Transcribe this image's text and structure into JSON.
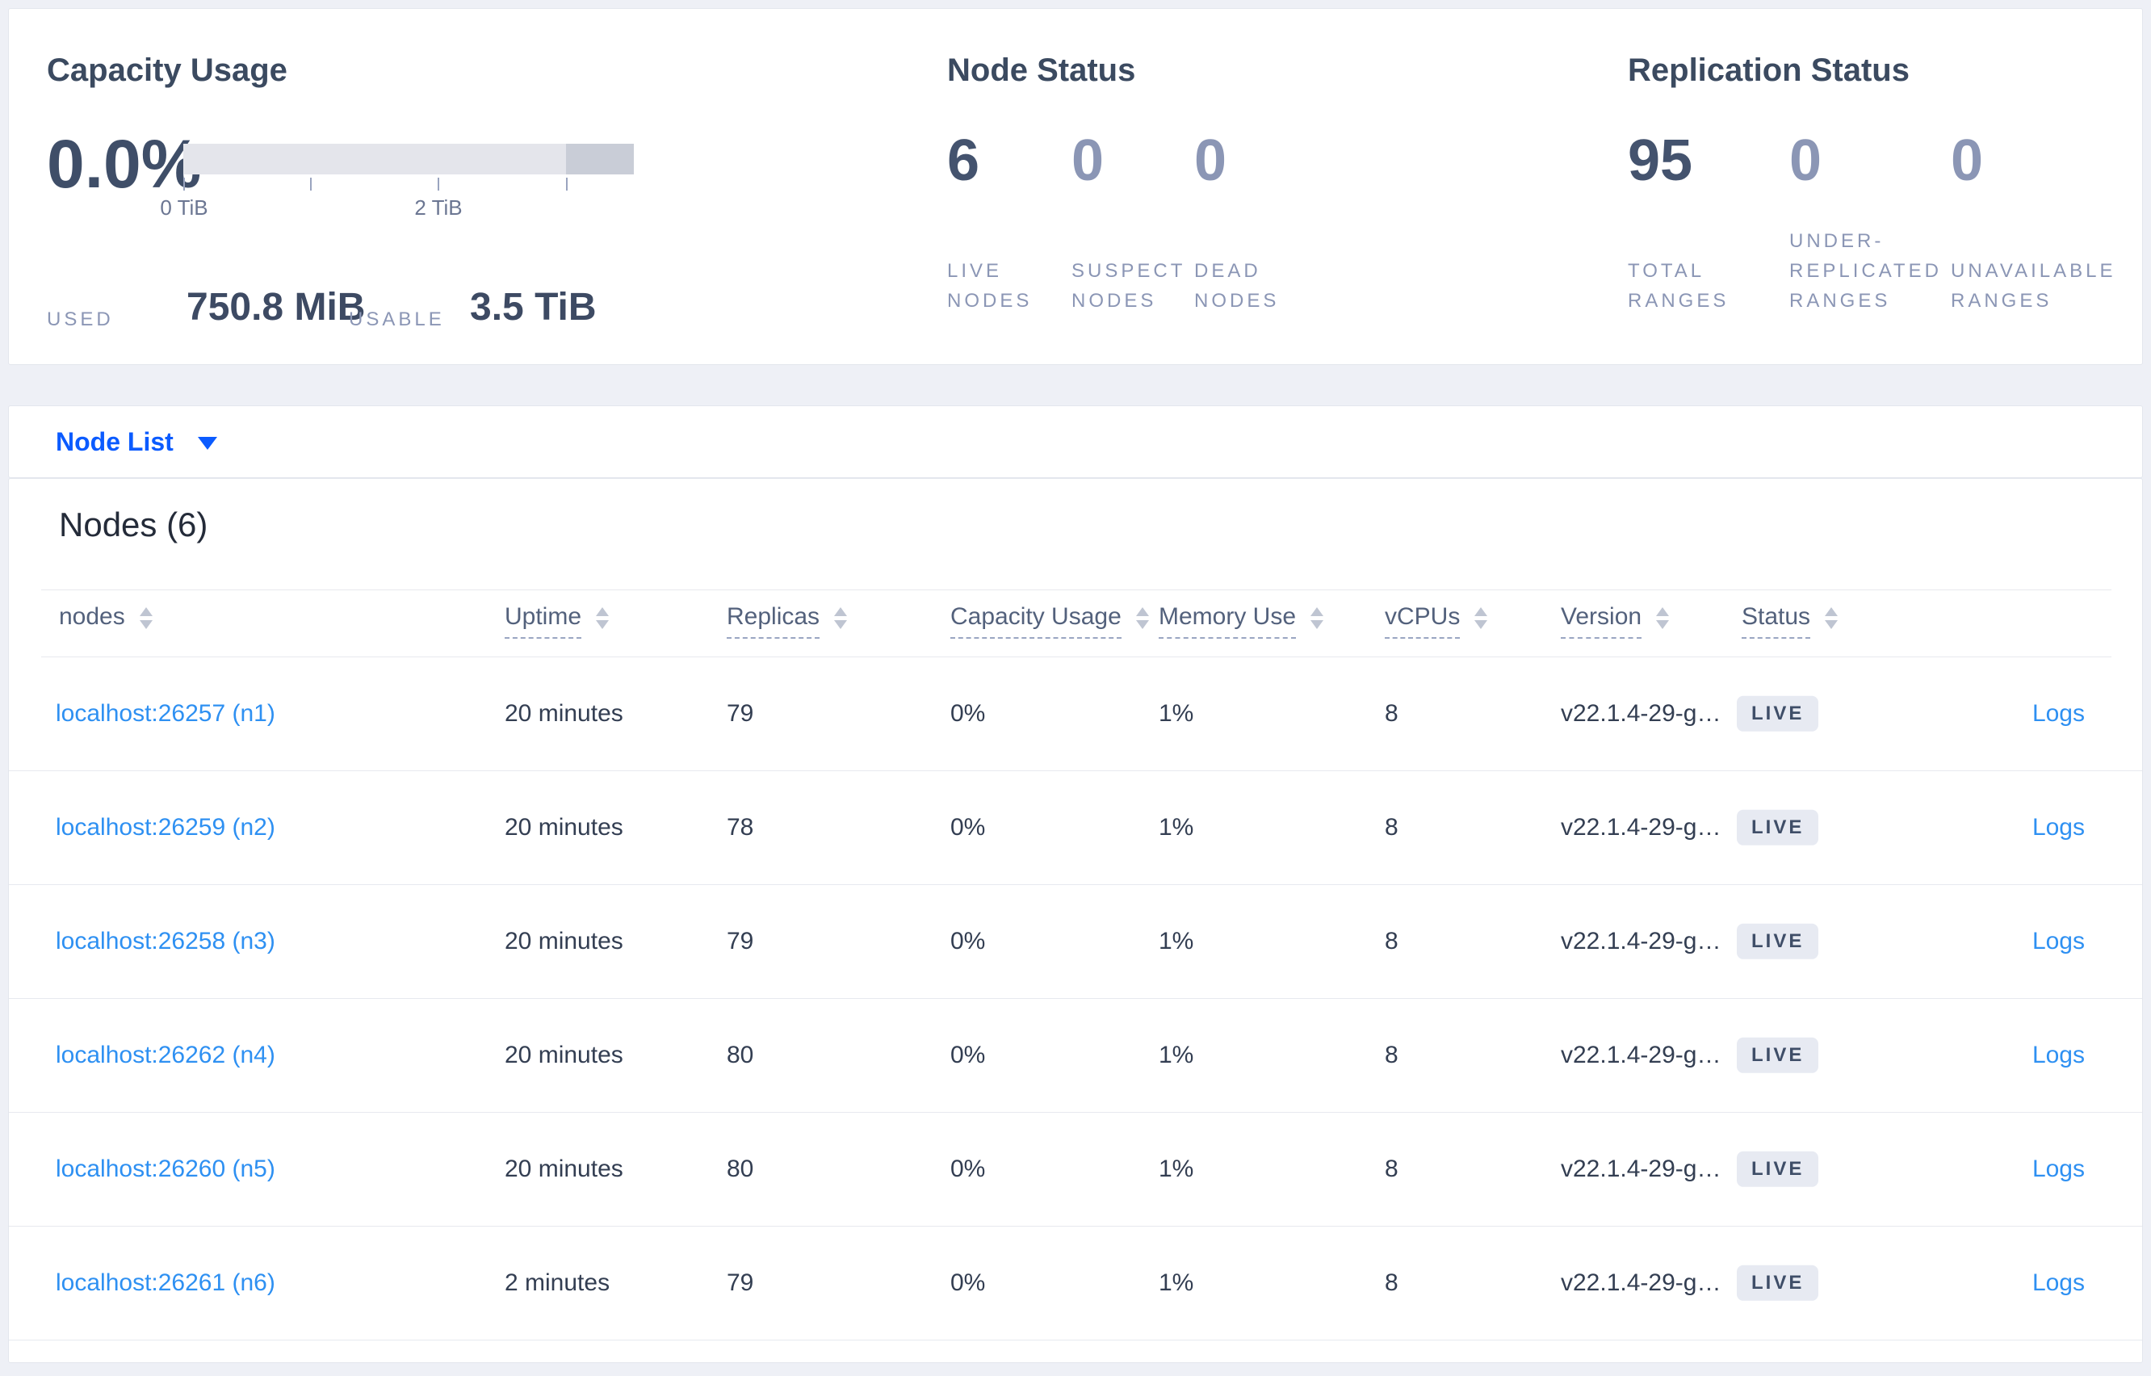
{
  "summary": {
    "capacity": {
      "title": "Capacity Usage",
      "percent": "0.0%",
      "axis_tick_labels": [
        "0 TiB",
        "2 TiB"
      ],
      "used_label": "USED",
      "used_value": "750.8 MiB",
      "usable_label": "USABLE",
      "usable_value": "3.5 TiB"
    },
    "node_status": {
      "title": "Node Status",
      "stats": [
        {
          "value": "6",
          "emphasis": "dark",
          "label_lines": [
            "LIVE",
            "NODES"
          ]
        },
        {
          "value": "0",
          "emphasis": "light",
          "label_lines": [
            "SUSPECT",
            "NODES"
          ]
        },
        {
          "value": "0",
          "emphasis": "light",
          "label_lines": [
            "DEAD",
            "NODES"
          ]
        }
      ]
    },
    "replication_status": {
      "title": "Replication Status",
      "stats": [
        {
          "value": "95",
          "emphasis": "dark",
          "label_lines": [
            "TOTAL",
            "RANGES"
          ]
        },
        {
          "value": "0",
          "emphasis": "light",
          "label_lines": [
            "UNDER-",
            "REPLICATED",
            "RANGES"
          ]
        },
        {
          "value": "0",
          "emphasis": "light",
          "label_lines": [
            "UNAVAILABLE",
            "RANGES"
          ]
        }
      ]
    }
  },
  "node_list_dropdown": {
    "label": "Node List"
  },
  "nodes_section": {
    "title": "Nodes (6)",
    "columns": [
      {
        "key": "node",
        "label": "nodes",
        "dashed": false
      },
      {
        "key": "uptime",
        "label": "Uptime",
        "dashed": true
      },
      {
        "key": "replicas",
        "label": "Replicas",
        "dashed": true
      },
      {
        "key": "cap",
        "label": "Capacity Usage",
        "dashed": true
      },
      {
        "key": "mem",
        "label": "Memory Use",
        "dashed": true
      },
      {
        "key": "vcpu",
        "label": "vCPUs",
        "dashed": true
      },
      {
        "key": "ver",
        "label": "Version",
        "dashed": true
      },
      {
        "key": "status",
        "label": "Status",
        "dashed": true
      }
    ],
    "rows": [
      {
        "node": "localhost:26257 (n1)",
        "uptime": "20 minutes",
        "replicas": "79",
        "cap": "0%",
        "mem": "1%",
        "vcpu": "8",
        "ver": "v22.1.4-29-g…",
        "status": "LIVE",
        "logs": "Logs"
      },
      {
        "node": "localhost:26259 (n2)",
        "uptime": "20 minutes",
        "replicas": "78",
        "cap": "0%",
        "mem": "1%",
        "vcpu": "8",
        "ver": "v22.1.4-29-g…",
        "status": "LIVE",
        "logs": "Logs"
      },
      {
        "node": "localhost:26258 (n3)",
        "uptime": "20 minutes",
        "replicas": "79",
        "cap": "0%",
        "mem": "1%",
        "vcpu": "8",
        "ver": "v22.1.4-29-g…",
        "status": "LIVE",
        "logs": "Logs"
      },
      {
        "node": "localhost:26262 (n4)",
        "uptime": "20 minutes",
        "replicas": "80",
        "cap": "0%",
        "mem": "1%",
        "vcpu": "8",
        "ver": "v22.1.4-29-g…",
        "status": "LIVE",
        "logs": "Logs"
      },
      {
        "node": "localhost:26260 (n5)",
        "uptime": "20 minutes",
        "replicas": "80",
        "cap": "0%",
        "mem": "1%",
        "vcpu": "8",
        "ver": "v22.1.4-29-g…",
        "status": "LIVE",
        "logs": "Logs"
      },
      {
        "node": "localhost:26261 (n6)",
        "uptime": "2 minutes",
        "replicas": "79",
        "cap": "0%",
        "mem": "1%",
        "vcpu": "8",
        "ver": "v22.1.4-29-g…",
        "status": "LIVE",
        "logs": "Logs"
      }
    ]
  },
  "colors": {
    "accent_blue": "#0b5bff",
    "link_blue": "#2e90f2",
    "stat_dark": "#44536e",
    "stat_light": "#8b96b5",
    "badge_bg": "#e7eaf2",
    "bar_track": "#e4e5eb",
    "bar_extra": "#c9cdd7",
    "page_bg": "#eef0f6"
  },
  "icons": {
    "sort": "sort-arrows-icon",
    "dropdown": "chevron-down-icon"
  }
}
